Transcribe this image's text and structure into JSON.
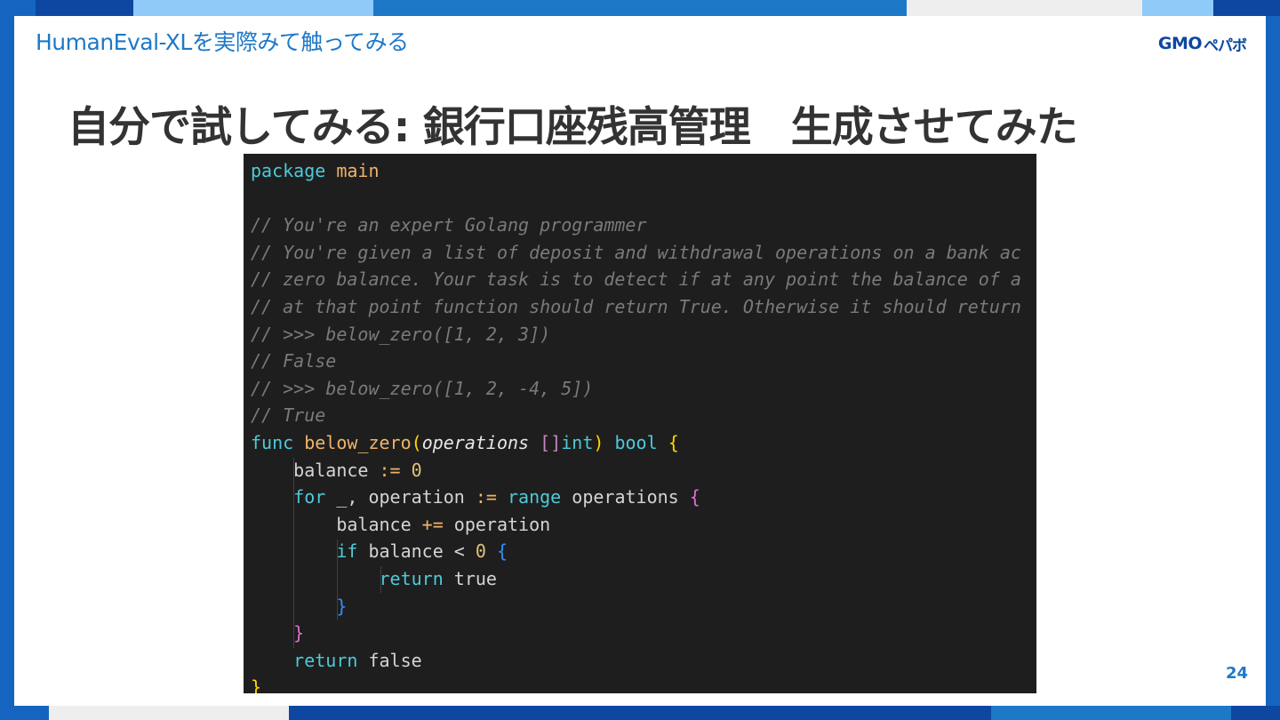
{
  "header": {
    "section_title": "HumanEval-XLを実際みて触ってみる"
  },
  "logo": {
    "gmo": "GMO",
    "brand": "ペパボ"
  },
  "slide": {
    "title": "自分で試してみる: 銀行口座残高管理　生成させてみた",
    "page_number": "24"
  },
  "code": {
    "language": "Golang",
    "lines": [
      {
        "parts": [
          {
            "t": "package",
            "k": "kw"
          },
          {
            "t": " "
          },
          {
            "t": "main",
            "k": "fn"
          }
        ]
      },
      {
        "parts": []
      },
      {
        "parts": [
          {
            "t": "// You're an expert Golang programmer",
            "k": "c"
          }
        ]
      },
      {
        "parts": [
          {
            "t": "// You're given a list of deposit and withdrawal operations on a bank ac",
            "k": "c"
          }
        ]
      },
      {
        "parts": [
          {
            "t": "// zero balance. Your task is to detect if at any point the balance of a",
            "k": "c"
          }
        ]
      },
      {
        "parts": [
          {
            "t": "// at that point function should return True. Otherwise it should return",
            "k": "c"
          }
        ]
      },
      {
        "parts": [
          {
            "t": "// >>> below_zero([1, 2, 3])",
            "k": "c"
          }
        ]
      },
      {
        "parts": [
          {
            "t": "// False",
            "k": "c"
          }
        ]
      },
      {
        "parts": [
          {
            "t": "// >>> below_zero([1, 2, -4, 5])",
            "k": "c"
          }
        ]
      },
      {
        "parts": [
          {
            "t": "// True",
            "k": "c"
          }
        ]
      },
      {
        "parts": [
          {
            "t": "func",
            "k": "kw"
          },
          {
            "t": " "
          },
          {
            "t": "below_zero",
            "k": "fn"
          },
          {
            "t": "(",
            "k": "b1"
          },
          {
            "t": "operations",
            "k": "it"
          },
          {
            "t": " "
          },
          {
            "t": "[]",
            "k": "type"
          },
          {
            "t": "int",
            "k": "kw"
          },
          {
            "t": ")",
            "k": "b1"
          },
          {
            "t": " "
          },
          {
            "t": "bool",
            "k": "kw"
          },
          {
            "t": " "
          },
          {
            "t": "{",
            "k": "b1"
          }
        ]
      },
      {
        "parts": [
          {
            "t": "    balance "
          },
          {
            "t": ":=",
            "k": "op"
          },
          {
            "t": " "
          },
          {
            "t": "0",
            "k": "num"
          }
        ]
      },
      {
        "parts": [
          {
            "t": "    "
          },
          {
            "t": "for",
            "k": "kw"
          },
          {
            "t": " _, operation "
          },
          {
            "t": ":=",
            "k": "op"
          },
          {
            "t": " "
          },
          {
            "t": "range",
            "k": "kw"
          },
          {
            "t": " operations "
          },
          {
            "t": "{",
            "k": "b2"
          }
        ]
      },
      {
        "parts": [
          {
            "t": "        balance "
          },
          {
            "t": "+=",
            "k": "op"
          },
          {
            "t": " operation"
          }
        ]
      },
      {
        "parts": [
          {
            "t": "        "
          },
          {
            "t": "if",
            "k": "kw"
          },
          {
            "t": " balance < "
          },
          {
            "t": "0",
            "k": "num"
          },
          {
            "t": " "
          },
          {
            "t": "{",
            "k": "b3"
          }
        ]
      },
      {
        "parts": [
          {
            "t": "            "
          },
          {
            "t": "return",
            "k": "kw"
          },
          {
            "t": " true"
          }
        ]
      },
      {
        "parts": [
          {
            "t": "        "
          },
          {
            "t": "}",
            "k": "b3"
          }
        ]
      },
      {
        "parts": [
          {
            "t": "    "
          },
          {
            "t": "}",
            "k": "b2"
          }
        ]
      },
      {
        "parts": [
          {
            "t": "    "
          },
          {
            "t": "return",
            "k": "kw"
          },
          {
            "t": " false"
          }
        ]
      },
      {
        "parts": [
          {
            "t": "}",
            "k": "b1"
          }
        ]
      }
    ]
  },
  "colors": {
    "accent_blue": "#1e78c8",
    "frame_blue": "#1565c0",
    "dark_blue": "#0d47a1",
    "light_blue": "#90caf9",
    "title_text": "#333333",
    "code_bg": "#1e1e1e"
  }
}
